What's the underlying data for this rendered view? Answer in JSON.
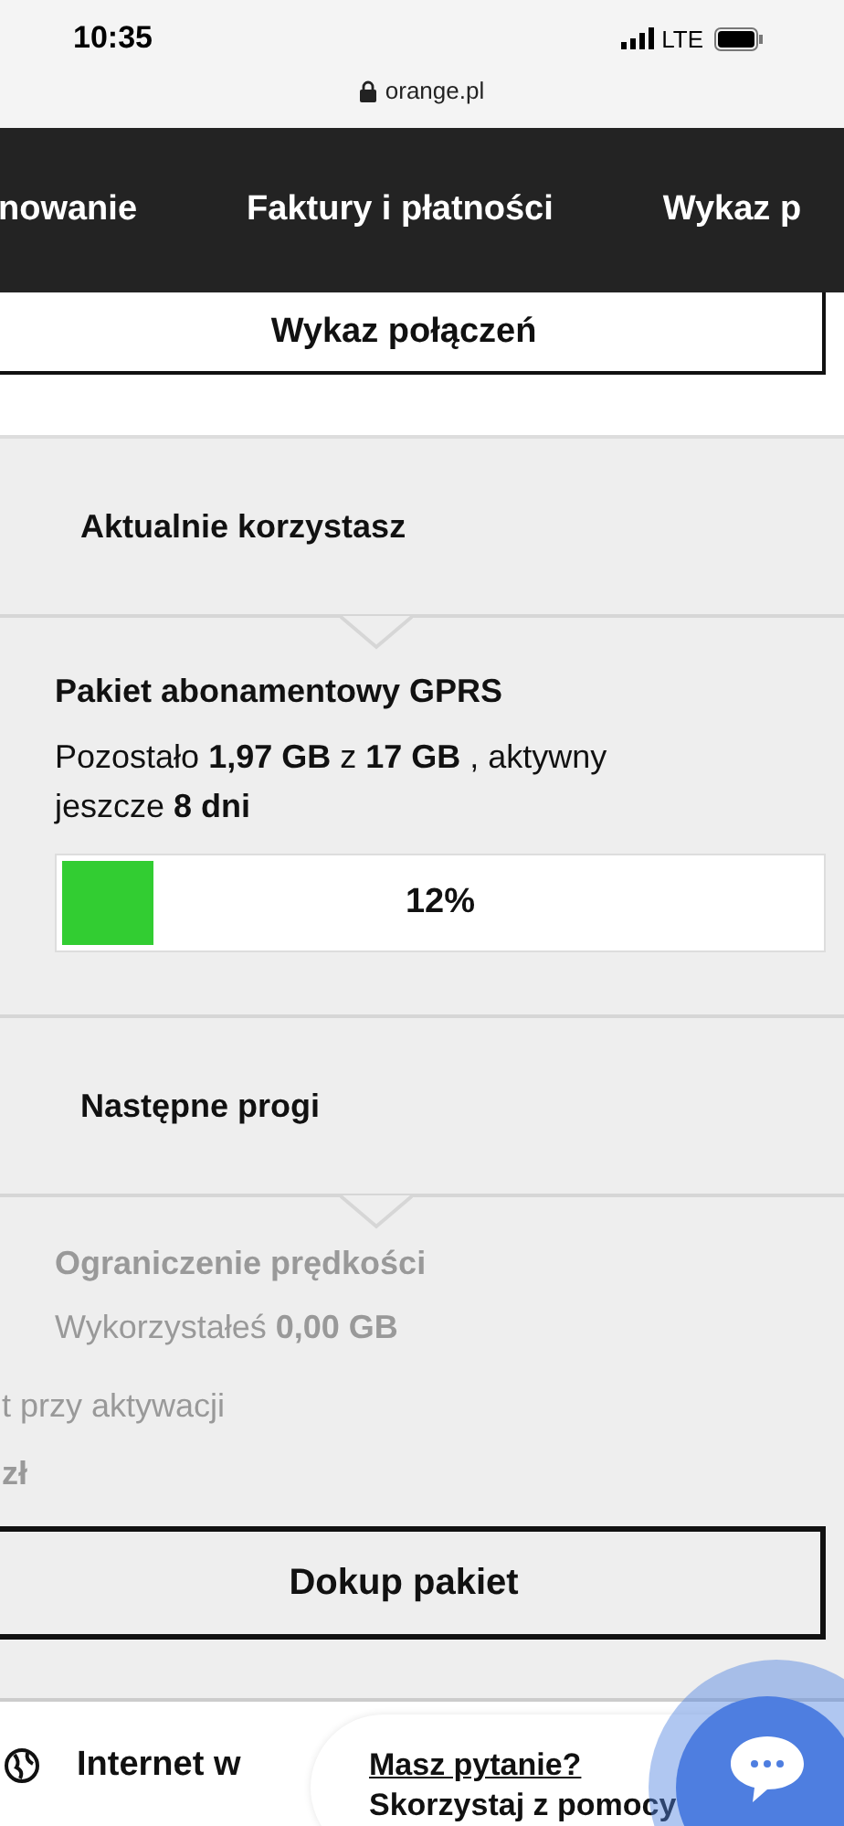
{
  "status_bar": {
    "time": "10:35",
    "network": "LTE"
  },
  "url_bar": {
    "address": "orange.pl"
  },
  "nav_tabs": [
    {
      "label": "nowanie"
    },
    {
      "label": "Faktury i płatności"
    },
    {
      "label": "Wykaz p"
    }
  ],
  "top_button": "Wykaz połączeń",
  "current": {
    "heading": "Aktualnie korzystasz",
    "package": "Pakiet abonamentowy GPRS",
    "usage": "Pozostało **1,97 GB** z **17 GB** , aktywny jeszcze **8 dni**",
    "level": 0.12,
    "percent": "12%"
  },
  "next": {
    "heading": "Następne progi",
    "title": "Ograniczenie prędkości",
    "usage": "Wykorzystałeś **0,00 GB**",
    "note": "t przy aktywacji",
    "price": "zł"
  },
  "buy_button": "Dokup pakiet",
  "footer": {
    "item": "Internet w",
    "chat_title": "Masz pytanie?",
    "chat_subtitle": "Skorzystaj z pomocy"
  }
}
